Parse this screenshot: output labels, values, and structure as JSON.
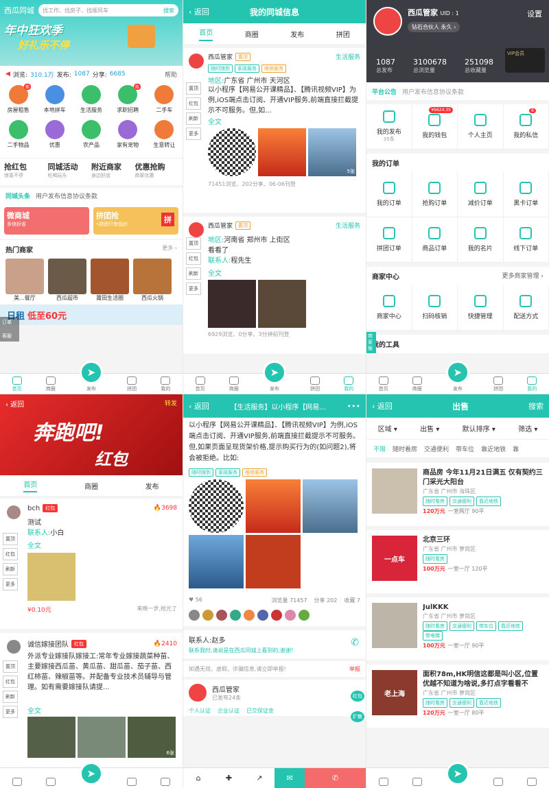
{
  "p1": {
    "city": "西瓜同城",
    "search_ph": "找工作、找房子、找顺风车",
    "search_btn": "搜索",
    "banner1": "年中狂欢季",
    "banner2": "好礼乐不停",
    "stats": {
      "views_l": "浏览:",
      "views": "310.1万",
      "pub_l": "发布:",
      "pub": "1087",
      "share_l": "分享:",
      "share": "6685",
      "help": "帮助"
    },
    "icons": [
      {
        "label": "房屋租售",
        "color": "#f07a3a",
        "badge": "新"
      },
      {
        "label": "本地拼车",
        "color": "#4a90e2",
        "badge": ""
      },
      {
        "label": "生活服务",
        "color": "#3cbf6a",
        "badge": ""
      },
      {
        "label": "求职招聘",
        "color": "#3cbf6a",
        "badge": "热"
      },
      {
        "label": "二手车",
        "color": "#f07a3a",
        "badge": ""
      },
      {
        "label": "二手物品",
        "color": "#3cbf6a",
        "badge": ""
      },
      {
        "label": "优惠",
        "color": "#9a6ad6",
        "badge": ""
      },
      {
        "label": "农产品",
        "color": "#3cbf6a",
        "badge": ""
      },
      {
        "label": "家有宠物",
        "color": "#9a6ad6",
        "badge": ""
      },
      {
        "label": "生意转让",
        "color": "#f07a3a",
        "badge": ""
      }
    ],
    "promos": [
      {
        "t": "抢红包",
        "s": "惊喜不停",
        "badge": "每日红包"
      },
      {
        "t": "同城活动",
        "s": "吃喝玩乐"
      },
      {
        "t": "附近商家",
        "s": "身边好店"
      },
      {
        "t": "优惠抢购",
        "s": "商家优惠"
      }
    ],
    "headline": "同城头条",
    "headline_txt": "用户发布信息协议条款",
    "card1": "微商城",
    "card1s": "多快好省",
    "card2": "拼团抢",
    "card2s": "•拼团只有低价",
    "card2i": "拼",
    "hot": "热门商家",
    "more": "更多 ›",
    "shops": [
      "美...餐厅",
      "西瓜超市",
      "莆田生活圈",
      "西瓜火锅"
    ],
    "float": "订单",
    "float2": "客服",
    "rent": "日租",
    "rent_price": "低至60元",
    "tabs": [
      "首页",
      "商圈",
      "发布",
      "拼团",
      "我的"
    ]
  },
  "p2": {
    "back": "‹ 返回",
    "title": "我的同城信息",
    "tabs": [
      "首页",
      "商圈",
      "发布",
      "拼团",
      "我的"
    ],
    "posts": [
      {
        "user": "西瓜管家",
        "badge": "置顶",
        "cat": "生活服务",
        "tags": [
          "随时随到",
          "家政服务",
          "维修服务"
        ],
        "area_l": "地区:",
        "area": "广东省 广州市 天河区",
        "text": "以小程序【网易公开课精品】、【腾讯视频VIP】为例,iOS端点击订阅、开通VIP服务,前端直接拦截提示不可服务。但,如...",
        "full": "全文",
        "cnt": "5张",
        "meta": "71451浏览、202分享、06-06刊登"
      },
      {
        "user": "西瓜管家",
        "badge": "置顶",
        "cat": "生活服务",
        "area_l": "地区:",
        "area": "河南省 郑州市 上街区",
        "text": "看看了",
        "contact_l": "联系人:",
        "contact": "程先生",
        "full": "全文",
        "meta": "6929浏览、0分享、3分钟前刊登"
      }
    ],
    "side": [
      "置顶",
      "红包",
      "刷新",
      "更多"
    ]
  },
  "p3": {
    "name": "西瓜管家",
    "uid": "UID : 1",
    "settings": "设置",
    "level": "钻石合伙人 永久 ›",
    "vip": "VIP会员",
    "stats": [
      {
        "v": "1087",
        "l": "总发布"
      },
      {
        "v": "3100678",
        "l": "总浏览量"
      },
      {
        "v": "251098",
        "l": "总收藏量"
      }
    ],
    "notice": "平台公告",
    "notice_txt": "用户发布信息协议条款",
    "top": [
      {
        "l": "我的发布",
        "s": "35条",
        "badge": ""
      },
      {
        "l": "我的钱包",
        "s": "",
        "badge": "¥9624.35"
      },
      {
        "l": "个人主页",
        "s": "",
        "badge": ""
      },
      {
        "l": "我的私信",
        "s": "",
        "badge": "6"
      }
    ],
    "orders_t": "我的订单",
    "orders": [
      "我的订单",
      "抢购订单",
      "减价订单",
      "黑卡订单",
      "拼团订单",
      "商品订单",
      "我的名片",
      "线下订单"
    ],
    "merchant_t": "商家中心",
    "merchant_more": "更多商家管理 ›",
    "merchant": [
      "商家中心",
      "扫码核销",
      "快捷管理",
      "配送方式"
    ],
    "tools_t": "我的工具",
    "float": "商家版",
    "tabs": [
      "首页",
      "商圈",
      "发布",
      "拼团",
      "我的"
    ]
  },
  "p4": {
    "back": "‹ 返回",
    "share": "转发",
    "banner1": "奔跑吧!",
    "banner2": "红包",
    "tabs": [
      "首页",
      "商圈",
      "发布",
      "拼团",
      "我的"
    ],
    "posts": [
      {
        "user": "bch",
        "badge": "红包",
        "hot": "3698",
        "t1": "测试",
        "contact_l": "联系人:",
        "contact": "小白",
        "full": "全文",
        "price": "¥0.10元",
        "note": "来晚一步,抢光了"
      },
      {
        "user": "诚信嫁接团队",
        "badge": "红包",
        "hot": "2410",
        "text": "外派专业嫁接队嫁接工:常年专业嫁接蔬菜种苗、主要嫁接西瓜苗、黄瓜苗、甜瓜苗、茄子苗、西红柿苗、辣椒苗等。并配备专业技术员辅导与管理。如有需要嫁接队请提...",
        "full": "全文",
        "cnt": "6张"
      }
    ],
    "side": [
      "置顶",
      "红包",
      "刷新",
      "更多"
    ]
  },
  "p5": {
    "back": "‹ 返回",
    "title": "【生活服务】以小程序【网易...",
    "dots": "•••",
    "text": "以小程序【网易公开课精品】、【腾讯视频VIP】为例,iOS端点击订阅、开通VIP服务,前端直接拦截提示不可服务。但,如果页面呈现货架价格,提示购买行为的(如问题2),将会被拒绝。比如:",
    "tags": [
      "随时随到",
      "家政服务",
      "维修服务"
    ],
    "likes": "56",
    "views": "浏览量 71457",
    "shares": "分享 202",
    "fav": "收藏 7",
    "contact_l": "联系人:",
    "contact": "赵多",
    "tip": "联系我时,请说是在西瓜同城上看到的,谢谢!",
    "report": "如遇无效、虚假、诈骗信息,请立即举报!",
    "report_btn": "举报",
    "user": "西瓜管家",
    "user_sub": "已发布24条",
    "certs": [
      "个人认证",
      "企业认证",
      "已交保证金"
    ],
    "float": "扩散",
    "float2": "红包"
  },
  "p6": {
    "back": "‹ 返回",
    "title": "出售",
    "search": "搜索",
    "filters": [
      "区域 ▾",
      "出售 ▾",
      "默认排序 ▾",
      "筛选 ▾"
    ],
    "chips": [
      "不限",
      "随时看房",
      "交通便利",
      "带车位",
      "靠近地铁",
      "靠"
    ],
    "list": [
      {
        "title": "商品房 今年11月21日满五 仅有契约三门采光大阳台",
        "loc": "广东省 广州市 海珠区",
        "tags": [
          "随时看房",
          "交通便利",
          "靠近地铁"
        ],
        "price": "120万元",
        "spec": "一室两厅 90平",
        "pic": "#cbbfae"
      },
      {
        "title": "北京三环",
        "loc": "广东省 广州市 萝岗区",
        "tags": [
          "随时看房"
        ],
        "price": "100万元",
        "spec": "一室一厅 120平",
        "pic": "#d8253a",
        "pict": "一点车"
      },
      {
        "title": "JulKKK",
        "loc": "广东省 广州市 萝岗区",
        "tags": [
          "随时看房",
          "交通便利",
          "带车位",
          "靠近地铁",
          "带电梯"
        ],
        "price": "100万元",
        "spec": "一室一厅 90平",
        "pic": "#bdb6a8"
      },
      {
        "title": "面积78m,HK明信这都是叫小区,位置优越不知道为啥说,多打点字看看不",
        "loc": "广东省 广州市 萝岗区",
        "tags": [
          "随时看房",
          "交通便利",
          "靠近地铁"
        ],
        "price": "120万元",
        "spec": "一室一厅 80平",
        "pic": "#8a3b2e",
        "pict": "老上海"
      }
    ]
  }
}
